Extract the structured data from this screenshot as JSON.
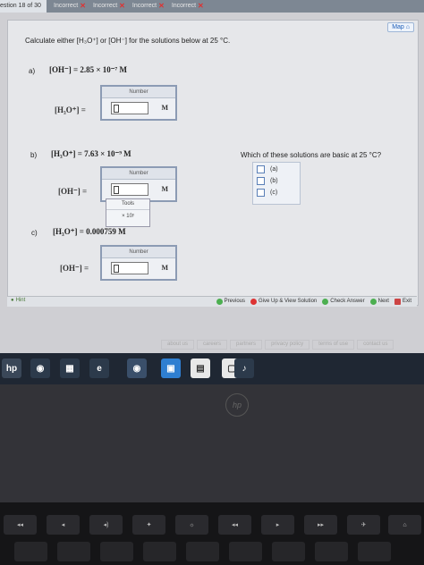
{
  "header": {
    "question_label": "estion 18 of 30",
    "tabs": [
      "Incorrect",
      "Incorrect",
      "Incorrect",
      "Incorrect"
    ]
  },
  "toolbar": {
    "map_label": "Map"
  },
  "prompt": "Calculate either [H₃O⁺] or [OH⁻] for the solutions below at 25 °C.",
  "parts": [
    {
      "label": "a)",
      "given": "[OH⁻] = 2.85 × 10⁻⁷ M",
      "ask": "[H₃O⁺] =",
      "box_label": "Number",
      "unit": "M"
    },
    {
      "label": "b)",
      "given": "[H₃O⁺] = 7.63 × 10⁻⁹ M",
      "ask": "[OH⁻] =",
      "box_label": "Number",
      "unit": "M"
    },
    {
      "label": "c)",
      "given": "[H₃O⁺] = 0.000759 M",
      "ask": "[OH⁻] =",
      "box_label": "Number",
      "unit": "M"
    }
  ],
  "tools": {
    "title": "Tools",
    "item": "× 10ʸ"
  },
  "side_question": {
    "text": "Which of these solutions are basic at 25 °C?",
    "options": [
      "(a)",
      "(b)",
      "(c)"
    ]
  },
  "bottom": {
    "hint": "Hint",
    "previous": "Previous",
    "give_up": "Give Up & View Solution",
    "check": "Check Answer",
    "next": "Next",
    "exit": "Exit"
  },
  "footer_links": [
    "about us",
    "careers",
    "partners",
    "privacy policy",
    "terms of use",
    "contact us"
  ],
  "colors": {
    "topbar": "#7d8793",
    "box_border": "#8c9bb4",
    "incorrect": "#dd3333"
  }
}
